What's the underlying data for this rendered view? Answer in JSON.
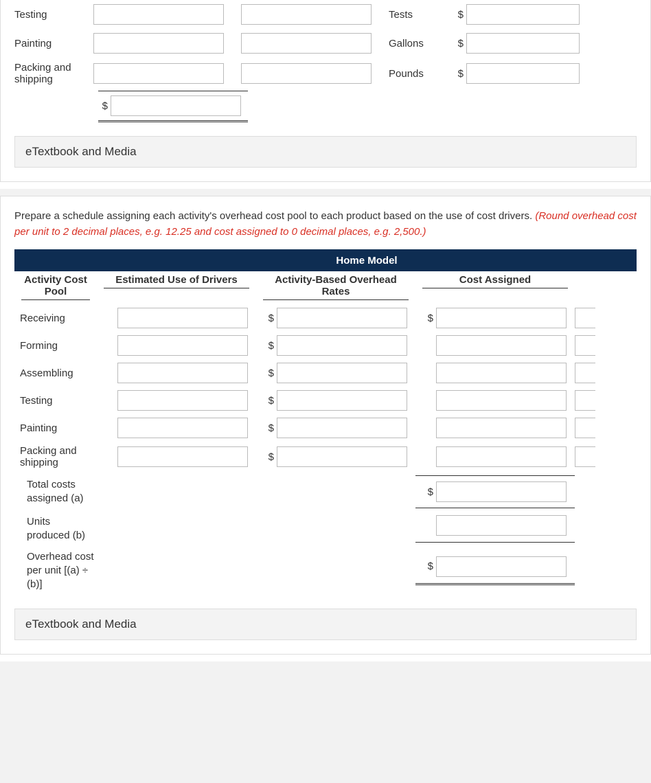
{
  "top_table": {
    "rows": [
      {
        "label": "Testing",
        "driver": "Tests"
      },
      {
        "label": "Painting",
        "driver": "Gallons"
      },
      {
        "label": "Packing and shipping",
        "driver": "Pounds"
      }
    ],
    "currency": "$"
  },
  "etextbook_label": "eTextbook and Media",
  "instruction": {
    "text": "Prepare a schedule assigning each activity's overhead cost pool to each product based on the use of cost drivers. ",
    "red": "(Round overhead cost per unit to 2 decimal places, e.g. 12.25 and cost assigned to 0 decimal places, e.g. 2,500.)"
  },
  "home_model": {
    "band_title": "Home Model",
    "headers": {
      "activity": "Activity Cost Pool",
      "est": "Estimated Use of Drivers",
      "rates": "Activity-Based Overhead Rates",
      "cost": "Cost Assigned"
    },
    "rows": [
      {
        "label": "Receiving",
        "show_first_dollar": true
      },
      {
        "label": "Forming",
        "show_first_dollar": false
      },
      {
        "label": "Assembling",
        "show_first_dollar": false
      },
      {
        "label": "Testing",
        "show_first_dollar": false
      },
      {
        "label": "Painting",
        "show_first_dollar": false
      },
      {
        "label": "Packing and shipping",
        "show_first_dollar": false
      }
    ],
    "summary": {
      "total": "Total costs assigned (a)",
      "units": "Units produced (b)",
      "overhead": "Overhead cost per unit [(a) ÷ (b)]"
    },
    "currency": "$"
  }
}
